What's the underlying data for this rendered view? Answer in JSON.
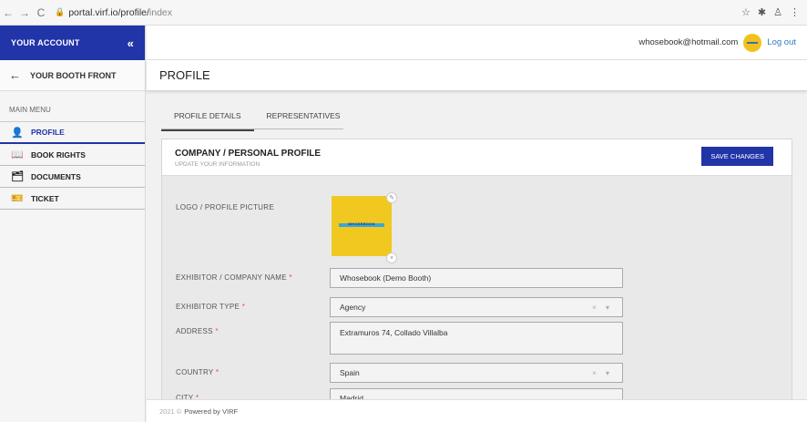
{
  "browser": {
    "back": "←",
    "forward": "→",
    "reload": "C",
    "url_host": "portal.virf.io/profile/",
    "url_path": "index",
    "star": "☆",
    "ext1": "✱",
    "ext2": "♙",
    "menu": "⋮"
  },
  "sidebar": {
    "account_label": "YOUR ACCOUNT",
    "collapse": "«",
    "booth_label": "YOUR BOOTH FRONT",
    "menu_title": "MAIN MENU",
    "items": [
      {
        "label": "PROFILE",
        "icon": "👤"
      },
      {
        "label": "BOOK RIGHTS",
        "icon": "📖"
      },
      {
        "label": "DOCUMENTS",
        "icon": "🗂"
      },
      {
        "label": "TICKET",
        "icon": "🎫"
      }
    ]
  },
  "topbar": {
    "email": "whosebook@hotmail.com",
    "logout": "Log out"
  },
  "page_title": "PROFILE",
  "tabs": [
    "PROFILE DETAILS",
    "REPRESENTATIVES"
  ],
  "card": {
    "title": "COMPANY / PERSONAL PROFILE",
    "subtitle": "UPDATE YOUR INFORMATION",
    "save": "SAVE CHANGES"
  },
  "form": {
    "logo_label": "LOGO / PROFILE PICTURE",
    "logo_text": "WHOSEBOOK",
    "name_label": "EXHIBITOR / COMPANY NAME",
    "name_value": "Whosebook (Demo Booth)",
    "type_label": "EXHIBITOR TYPE",
    "type_value": "Agency",
    "address_label": "ADDRESS",
    "address_value": "Extramuros 74, Collado Villalba",
    "country_label": "COUNTRY",
    "country_value": "Spain",
    "city_label": "CITY",
    "city_value": "Madrid",
    "required": "*",
    "select_controls": "× ▾"
  },
  "footer": {
    "year": "2021 ©",
    "text": "Powered by VIRF"
  },
  "colors": {
    "primary": "#2134a8",
    "logo_bg": "#f1c81f",
    "link": "#2e7cc7"
  }
}
